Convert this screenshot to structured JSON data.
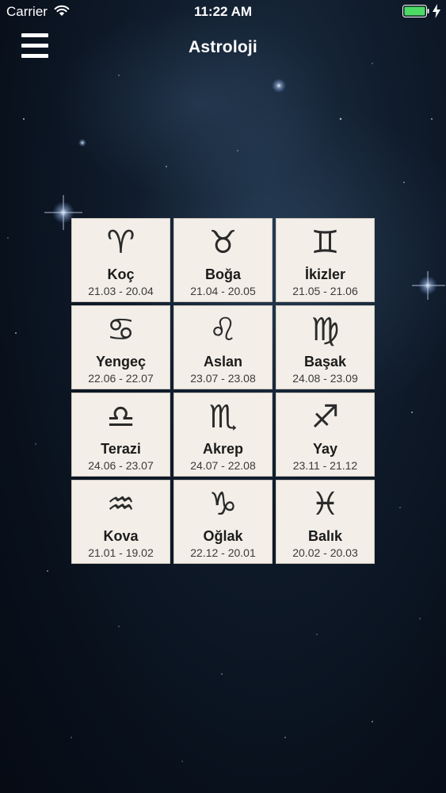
{
  "status_bar": {
    "carrier": "Carrier",
    "time": "11:22 AM"
  },
  "nav": {
    "title": "Astroloji",
    "menu_icon": "hamburger-menu-icon"
  },
  "colors": {
    "cell_background": "#f3eee8",
    "battery_green": "#4cd964",
    "text_dark": "#1b1b1b"
  },
  "signs": [
    {
      "glyph": "♈",
      "icon": "aries-icon",
      "name": "Koç",
      "dates": "21.03 - 20.04"
    },
    {
      "glyph": "♉",
      "icon": "taurus-icon",
      "name": "Boğa",
      "dates": "21.04 - 20.05"
    },
    {
      "glyph": "♊",
      "icon": "gemini-icon",
      "name": "İkizler",
      "dates": "21.05 - 21.06"
    },
    {
      "glyph": "♋",
      "icon": "cancer-icon",
      "name": "Yengeç",
      "dates": "22.06 - 22.07"
    },
    {
      "glyph": "♌",
      "icon": "leo-icon",
      "name": "Aslan",
      "dates": "23.07 - 23.08"
    },
    {
      "glyph": "♍",
      "icon": "virgo-icon",
      "name": "Başak",
      "dates": "24.08 - 23.09"
    },
    {
      "glyph": "♎",
      "icon": "libra-icon",
      "name": "Terazi",
      "dates": "24.06 - 23.07"
    },
    {
      "glyph": "♏",
      "icon": "scorpio-icon",
      "name": "Akrep",
      "dates": "24.07 - 22.08"
    },
    {
      "glyph": "♐",
      "icon": "sagittarius-icon",
      "name": "Yay",
      "dates": "23.11 - 21.12"
    },
    {
      "glyph": "♒",
      "icon": "aquarius-icon",
      "name": "Kova",
      "dates": "21.01 - 19.02"
    },
    {
      "glyph": "♑",
      "icon": "capricorn-icon",
      "name": "Oğlak",
      "dates": "22.12 - 20.01"
    },
    {
      "glyph": "♓",
      "icon": "pisces-icon",
      "name": "Balık",
      "dates": "20.02 - 20.03"
    }
  ]
}
